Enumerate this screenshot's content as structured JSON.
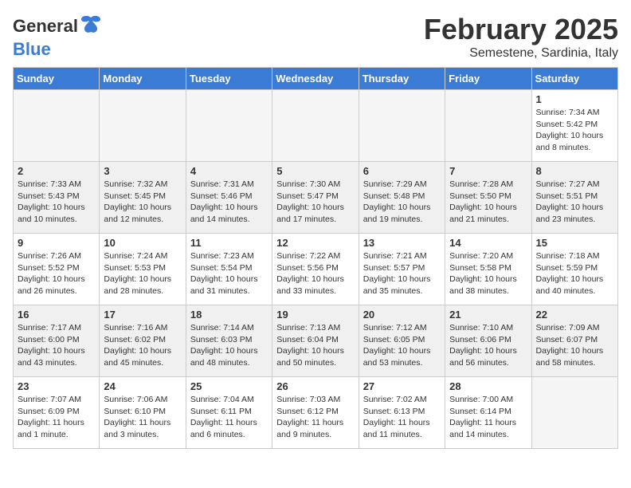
{
  "header": {
    "logo_general": "General",
    "logo_blue": "Blue",
    "month": "February 2025",
    "location": "Semestene, Sardinia, Italy"
  },
  "weekdays": [
    "Sunday",
    "Monday",
    "Tuesday",
    "Wednesday",
    "Thursday",
    "Friday",
    "Saturday"
  ],
  "weeks": [
    [
      {
        "day": "",
        "detail": ""
      },
      {
        "day": "",
        "detail": ""
      },
      {
        "day": "",
        "detail": ""
      },
      {
        "day": "",
        "detail": ""
      },
      {
        "day": "",
        "detail": ""
      },
      {
        "day": "",
        "detail": ""
      },
      {
        "day": "1",
        "detail": "Sunrise: 7:34 AM\nSunset: 5:42 PM\nDaylight: 10 hours\nand 8 minutes."
      }
    ],
    [
      {
        "day": "2",
        "detail": "Sunrise: 7:33 AM\nSunset: 5:43 PM\nDaylight: 10 hours\nand 10 minutes."
      },
      {
        "day": "3",
        "detail": "Sunrise: 7:32 AM\nSunset: 5:45 PM\nDaylight: 10 hours\nand 12 minutes."
      },
      {
        "day": "4",
        "detail": "Sunrise: 7:31 AM\nSunset: 5:46 PM\nDaylight: 10 hours\nand 14 minutes."
      },
      {
        "day": "5",
        "detail": "Sunrise: 7:30 AM\nSunset: 5:47 PM\nDaylight: 10 hours\nand 17 minutes."
      },
      {
        "day": "6",
        "detail": "Sunrise: 7:29 AM\nSunset: 5:48 PM\nDaylight: 10 hours\nand 19 minutes."
      },
      {
        "day": "7",
        "detail": "Sunrise: 7:28 AM\nSunset: 5:50 PM\nDaylight: 10 hours\nand 21 minutes."
      },
      {
        "day": "8",
        "detail": "Sunrise: 7:27 AM\nSunset: 5:51 PM\nDaylight: 10 hours\nand 23 minutes."
      }
    ],
    [
      {
        "day": "9",
        "detail": "Sunrise: 7:26 AM\nSunset: 5:52 PM\nDaylight: 10 hours\nand 26 minutes."
      },
      {
        "day": "10",
        "detail": "Sunrise: 7:24 AM\nSunset: 5:53 PM\nDaylight: 10 hours\nand 28 minutes."
      },
      {
        "day": "11",
        "detail": "Sunrise: 7:23 AM\nSunset: 5:54 PM\nDaylight: 10 hours\nand 31 minutes."
      },
      {
        "day": "12",
        "detail": "Sunrise: 7:22 AM\nSunset: 5:56 PM\nDaylight: 10 hours\nand 33 minutes."
      },
      {
        "day": "13",
        "detail": "Sunrise: 7:21 AM\nSunset: 5:57 PM\nDaylight: 10 hours\nand 35 minutes."
      },
      {
        "day": "14",
        "detail": "Sunrise: 7:20 AM\nSunset: 5:58 PM\nDaylight: 10 hours\nand 38 minutes."
      },
      {
        "day": "15",
        "detail": "Sunrise: 7:18 AM\nSunset: 5:59 PM\nDaylight: 10 hours\nand 40 minutes."
      }
    ],
    [
      {
        "day": "16",
        "detail": "Sunrise: 7:17 AM\nSunset: 6:00 PM\nDaylight: 10 hours\nand 43 minutes."
      },
      {
        "day": "17",
        "detail": "Sunrise: 7:16 AM\nSunset: 6:02 PM\nDaylight: 10 hours\nand 45 minutes."
      },
      {
        "day": "18",
        "detail": "Sunrise: 7:14 AM\nSunset: 6:03 PM\nDaylight: 10 hours\nand 48 minutes."
      },
      {
        "day": "19",
        "detail": "Sunrise: 7:13 AM\nSunset: 6:04 PM\nDaylight: 10 hours\nand 50 minutes."
      },
      {
        "day": "20",
        "detail": "Sunrise: 7:12 AM\nSunset: 6:05 PM\nDaylight: 10 hours\nand 53 minutes."
      },
      {
        "day": "21",
        "detail": "Sunrise: 7:10 AM\nSunset: 6:06 PM\nDaylight: 10 hours\nand 56 minutes."
      },
      {
        "day": "22",
        "detail": "Sunrise: 7:09 AM\nSunset: 6:07 PM\nDaylight: 10 hours\nand 58 minutes."
      }
    ],
    [
      {
        "day": "23",
        "detail": "Sunrise: 7:07 AM\nSunset: 6:09 PM\nDaylight: 11 hours\nand 1 minute."
      },
      {
        "day": "24",
        "detail": "Sunrise: 7:06 AM\nSunset: 6:10 PM\nDaylight: 11 hours\nand 3 minutes."
      },
      {
        "day": "25",
        "detail": "Sunrise: 7:04 AM\nSunset: 6:11 PM\nDaylight: 11 hours\nand 6 minutes."
      },
      {
        "day": "26",
        "detail": "Sunrise: 7:03 AM\nSunset: 6:12 PM\nDaylight: 11 hours\nand 9 minutes."
      },
      {
        "day": "27",
        "detail": "Sunrise: 7:02 AM\nSunset: 6:13 PM\nDaylight: 11 hours\nand 11 minutes."
      },
      {
        "day": "28",
        "detail": "Sunrise: 7:00 AM\nSunset: 6:14 PM\nDaylight: 11 hours\nand 14 minutes."
      },
      {
        "day": "",
        "detail": ""
      }
    ]
  ]
}
